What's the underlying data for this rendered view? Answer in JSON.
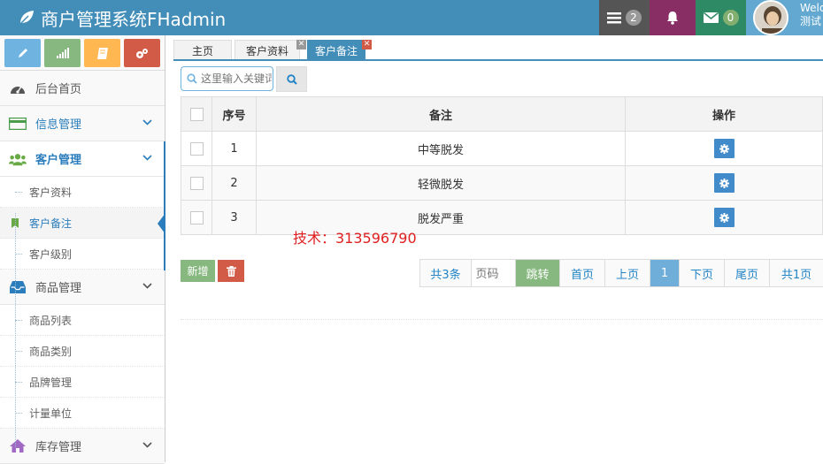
{
  "app": {
    "title": "商户管理系统FHadmin"
  },
  "header": {
    "tasks_count": "2",
    "messages_count": "0",
    "user_welcome": "Welcome",
    "user_name": "测试",
    "colors": {
      "navbar": "#438eb9",
      "tasks": "#555555",
      "notifications": "#892e65",
      "messages": "#2e8965",
      "user": "#62a8d1"
    }
  },
  "sidebar": {
    "shortcuts": [
      {
        "icon": "pencil-icon",
        "color": "#6fb3e0"
      },
      {
        "icon": "signal-icon",
        "color": "#87b87f"
      },
      {
        "icon": "book-icon",
        "color": "#ffb752"
      },
      {
        "icon": "cogs-icon",
        "color": "#d15b47"
      }
    ],
    "menu": [
      {
        "label": "后台首页",
        "icon": "dashboard-icon"
      },
      {
        "label": "信息管理",
        "icon": "credit-card-icon"
      },
      {
        "label": "客户管理",
        "icon": "group-icon"
      },
      {
        "label": "商品管理",
        "icon": "inbox-icon"
      },
      {
        "label": "库存管理",
        "icon": "home-icon"
      }
    ],
    "customer_sub": [
      "客户资料",
      "客户备注",
      "客户级别"
    ],
    "product_sub": [
      "商品列表",
      "商品类别",
      "品牌管理",
      "计量单位"
    ]
  },
  "tabs": [
    {
      "label": "主页",
      "closable": false
    },
    {
      "label": "客户资料",
      "closable": true
    },
    {
      "label": "客户备注",
      "closable": true
    }
  ],
  "search": {
    "placeholder": "这里输入关键词"
  },
  "table": {
    "headers": {
      "index": "序号",
      "remark": "备注",
      "action": "操作"
    },
    "rows": [
      {
        "index": "1",
        "remark": "中等脱发"
      },
      {
        "index": "2",
        "remark": "轻微脱发"
      },
      {
        "index": "3",
        "remark": "脱发严重"
      }
    ]
  },
  "watermark": "技术：313596790",
  "actions": {
    "new_label": "新增"
  },
  "pagination": {
    "total": "共3条",
    "page_placeholder": "页码",
    "jump": "跳转",
    "first": "首页",
    "prev": "上页",
    "current": "1",
    "next": "下页",
    "last": "尾页",
    "page_count": "共1页"
  }
}
